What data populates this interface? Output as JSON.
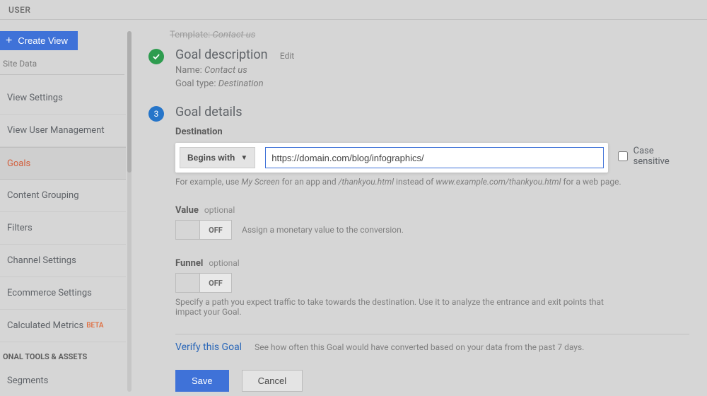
{
  "topbar": {
    "label": "USER"
  },
  "sidebar": {
    "create_view": "Create View",
    "site_data": "Site Data",
    "items": [
      {
        "label": "View Settings"
      },
      {
        "label": "View User Management"
      },
      {
        "label": "Goals"
      },
      {
        "label": "Content Grouping"
      },
      {
        "label": "Filters"
      },
      {
        "label": "Channel Settings"
      },
      {
        "label": "Ecommerce Settings"
      },
      {
        "label": "Calculated Metrics"
      }
    ],
    "beta": "BETA",
    "section_personal": "ONAL TOOLS & ASSETS",
    "segments": "Segments"
  },
  "template": {
    "label": "Template:",
    "value": "Contact us"
  },
  "desc": {
    "title": "Goal description",
    "edit": "Edit",
    "name_label": "Name:",
    "name_value": "Contact us",
    "type_label": "Goal type:",
    "type_value": "Destination"
  },
  "details": {
    "title": "Goal details",
    "step_num": "3",
    "destination": {
      "label": "Destination",
      "match_type": "Begins with",
      "value": "https://domain.com/blog/infographics/",
      "case_sensitive": "Case sensitive",
      "hint_pre": "For example, use ",
      "hint_i1": "My Screen",
      "hint_mid": " for an app and ",
      "hint_i2": "/thankyou.html",
      "hint_mid2": " instead of ",
      "hint_i3": "www.example.com/thankyou.html",
      "hint_post": " for a web page."
    },
    "value": {
      "label": "Value",
      "optional": "optional",
      "toggle": "OFF",
      "desc": "Assign a monetary value to the conversion."
    },
    "funnel": {
      "label": "Funnel",
      "optional": "optional",
      "toggle": "OFF",
      "desc": "Specify a path you expect traffic to take towards the destination. Use it to analyze the entrance and exit points that impact your Goal."
    }
  },
  "verify": {
    "link": "Verify this Goal",
    "desc": "See how often this Goal would have converted based on your data from the past 7 days."
  },
  "buttons": {
    "save": "Save",
    "cancel": "Cancel"
  }
}
